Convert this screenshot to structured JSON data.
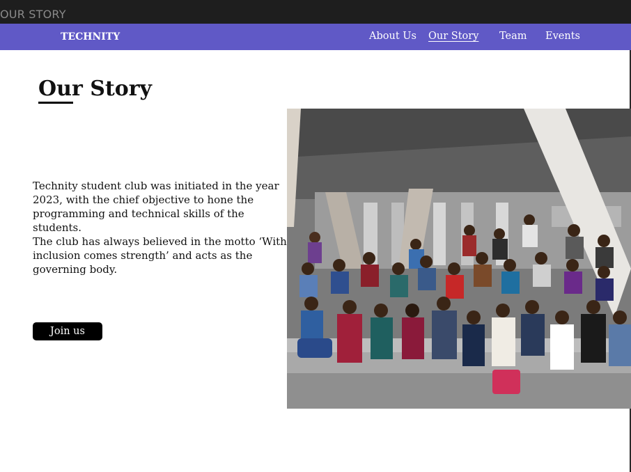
{
  "window": {
    "title": "OUR STORY"
  },
  "navbar": {
    "brand": "TECHNITY",
    "links": [
      {
        "label": "About Us",
        "active": false
      },
      {
        "label": "Our Story",
        "active": true
      },
      {
        "label": "Team",
        "active": false
      },
      {
        "label": "Events",
        "active": false
      }
    ],
    "background_color": "#6059c6"
  },
  "main": {
    "title": "Our Story",
    "paragraphs": [
      "Technity student club was initiated in the year 2023, with the chief objective to hone the programming and technical skills of the students.",
      "The club has always believed in the motto ‘With inclusion comes strength’ and acts as the governing body."
    ],
    "cta_label": "Join us"
  }
}
